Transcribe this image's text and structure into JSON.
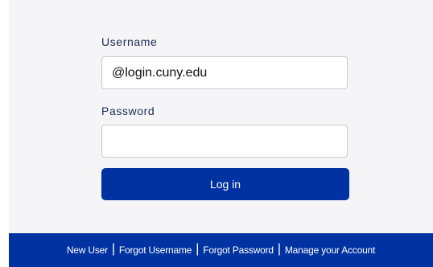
{
  "form": {
    "username_label": "Username",
    "username_value": "@login.cuny.edu",
    "password_label": "Password",
    "password_value": "",
    "login_label": "Log in"
  },
  "footer": {
    "links": [
      "New User",
      "Forgot Username",
      "Forgot Password",
      "Manage your Account"
    ],
    "separator": "|"
  },
  "colors": {
    "accent": "#0033a1",
    "panel_background": "#f5f5f7",
    "label_text": "#1e2a55"
  }
}
